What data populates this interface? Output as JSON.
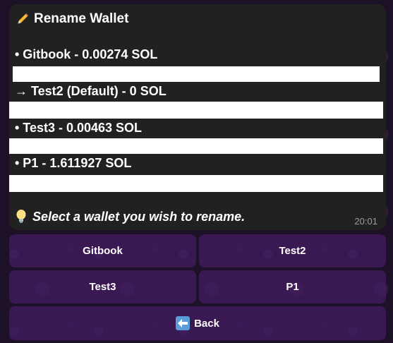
{
  "message": {
    "title": "Rename Wallet",
    "title_icon": "pencil-icon",
    "wallets": [
      "• Gitbook - 0.00274 SOL",
      "→ Test2 (Default) - 0 SOL",
      "• Test3 - 0.00463 SOL",
      "• P1 - 1.611927 SOL"
    ],
    "prompt": "Select a wallet you wish to rename.",
    "prompt_icon": "light-bulb-icon",
    "time": "20:01"
  },
  "keyboard": {
    "rows": [
      [
        "Gitbook",
        "Test2"
      ],
      [
        "Test3",
        "P1"
      ],
      [
        "Back"
      ]
    ],
    "back_icon": "back-arrow-icon"
  },
  "colors": {
    "bubble_bg": "#212121",
    "button_bg": "#421c60",
    "accent_back_icon": "#4a90e2"
  }
}
